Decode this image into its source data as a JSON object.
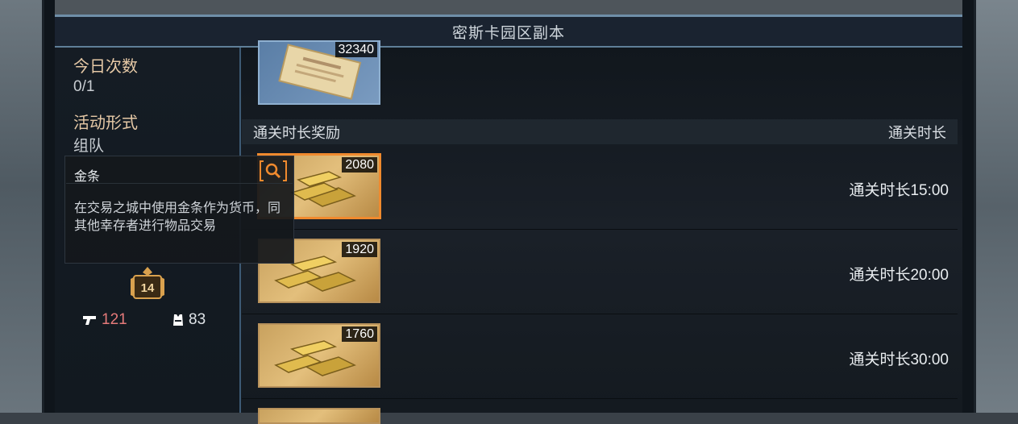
{
  "window": {
    "title": "密斯卡园区副本"
  },
  "info": {
    "count_label": "今日次数",
    "count_value": "0/1",
    "form_label": "活动形式",
    "form_value": "组队",
    "level": "14",
    "attack": "121",
    "armor": "83"
  },
  "top_item": {
    "count": "32340"
  },
  "section": {
    "title": "通关时长奖励",
    "right_label": "通关时长"
  },
  "rewards": [
    {
      "count": "2080",
      "time": "通关时长15:00"
    },
    {
      "count": "1920",
      "time": "通关时长20:00"
    },
    {
      "count": "1760",
      "time": "通关时长30:00"
    }
  ],
  "tooltip": {
    "title": "金条",
    "desc": "在交易之城中使用金条作为货币，同其他幸存者进行物品交易"
  },
  "colors": {
    "accent": "#f08a2e",
    "label": "#e6c9a6",
    "attack": "#e57a7a",
    "frame_line": "#6f8fa8"
  }
}
